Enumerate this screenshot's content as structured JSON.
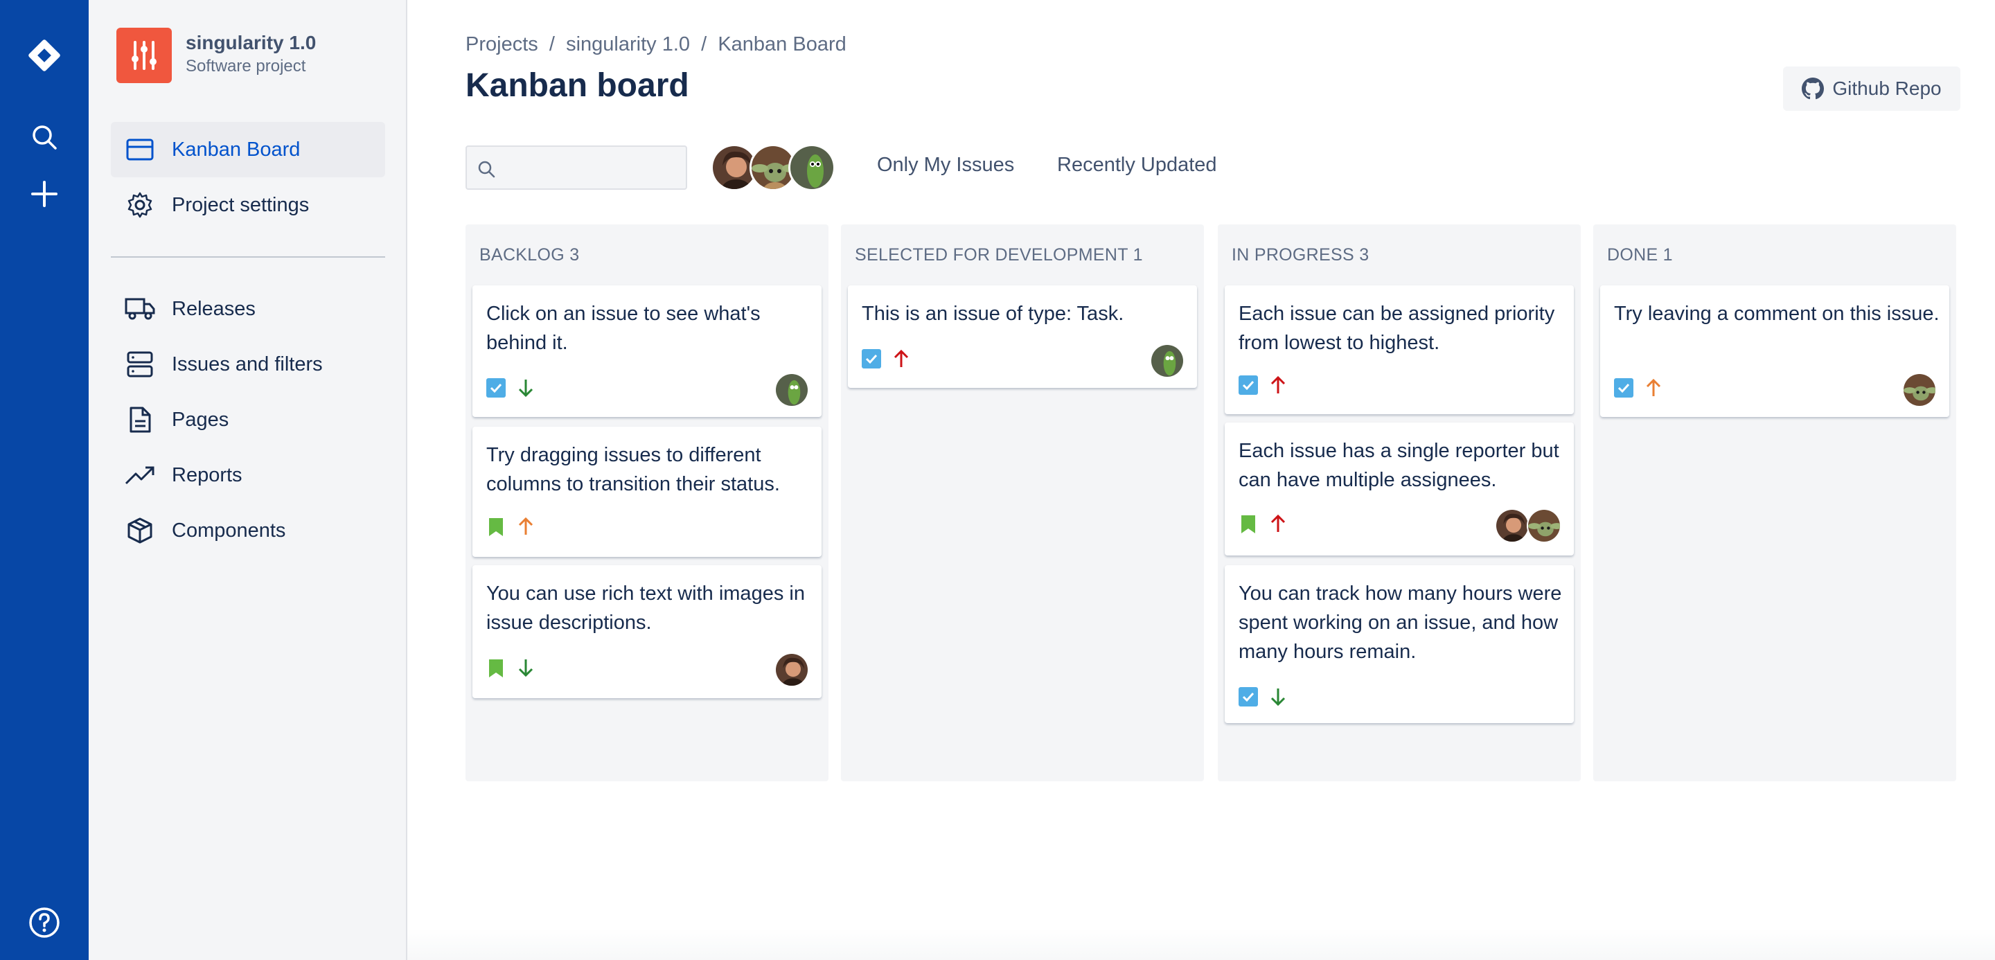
{
  "colors": {
    "nav_bg": "#0747a6",
    "sidebar_bg": "#f4f5f7",
    "project_avatar": "#f0573e",
    "active_link": "#0052cc",
    "task_icon": "#4fade6",
    "story_icon": "#65ba43",
    "priority_high": "#cd1317",
    "priority_medium": "#e97f33",
    "priority_low": "#2a8735"
  },
  "nav": {
    "icons": [
      "jira-logo-icon",
      "search-icon",
      "plus-icon",
      "help-icon"
    ]
  },
  "project": {
    "name": "singularity 1.0",
    "type": "Software project"
  },
  "sidebar": {
    "items": [
      {
        "label": "Kanban Board",
        "icon": "board-icon",
        "active": true
      },
      {
        "label": "Project settings",
        "icon": "gear-icon",
        "active": false
      },
      {
        "label": "Releases",
        "icon": "truck-icon",
        "active": false
      },
      {
        "label": "Issues and filters",
        "icon": "server-icon",
        "active": false
      },
      {
        "label": "Pages",
        "icon": "document-icon",
        "active": false
      },
      {
        "label": "Reports",
        "icon": "trend-icon",
        "active": false
      },
      {
        "label": "Components",
        "icon": "box-icon",
        "active": false
      }
    ]
  },
  "breadcrumb": [
    "Projects",
    "/",
    "singularity 1.0",
    "/",
    "Kanban Board"
  ],
  "page_title": "Kanban board",
  "github_button": "Github Repo",
  "search": {
    "value": "",
    "placeholder": ""
  },
  "filters": {
    "only_my_issues": "Only My Issues",
    "recently_updated": "Recently Updated"
  },
  "board": {
    "columns": [
      {
        "title": "Backlog 3",
        "cards": [
          {
            "title": "Click on an issue to see what's behind it.",
            "type": "task",
            "priority": "low",
            "assignees": [
              "green"
            ]
          },
          {
            "title": "Try dragging issues to different columns to transition their status.",
            "type": "story",
            "priority": "medium",
            "assignees": []
          },
          {
            "title": "You can use rich text with images in issue descriptions.",
            "type": "story",
            "priority": "low",
            "assignees": [
              "brown"
            ]
          }
        ]
      },
      {
        "title": "Selected for development 1",
        "cards": [
          {
            "title": "This is an issue of type: Task.",
            "type": "task",
            "priority": "high",
            "assignees": [
              "green"
            ]
          }
        ]
      },
      {
        "title": "In progress 3",
        "cards": [
          {
            "title": "Each issue can be assigned priority from lowest to highest.",
            "type": "task",
            "priority": "high",
            "assignees": []
          },
          {
            "title": "Each issue has a single reporter but can have multiple assignees.",
            "type": "story",
            "priority": "high",
            "assignees": [
              "brown",
              "yoda"
            ]
          },
          {
            "title": "You can track how many hours were spent working on an issue, and how many hours remain.",
            "type": "task",
            "priority": "low",
            "assignees": []
          }
        ]
      },
      {
        "title": "Done 1",
        "cards": [
          {
            "title": "Try leaving a comment on this issue.",
            "type": "task",
            "priority": "medium",
            "assignees": [
              "yoda"
            ]
          }
        ]
      }
    ]
  }
}
